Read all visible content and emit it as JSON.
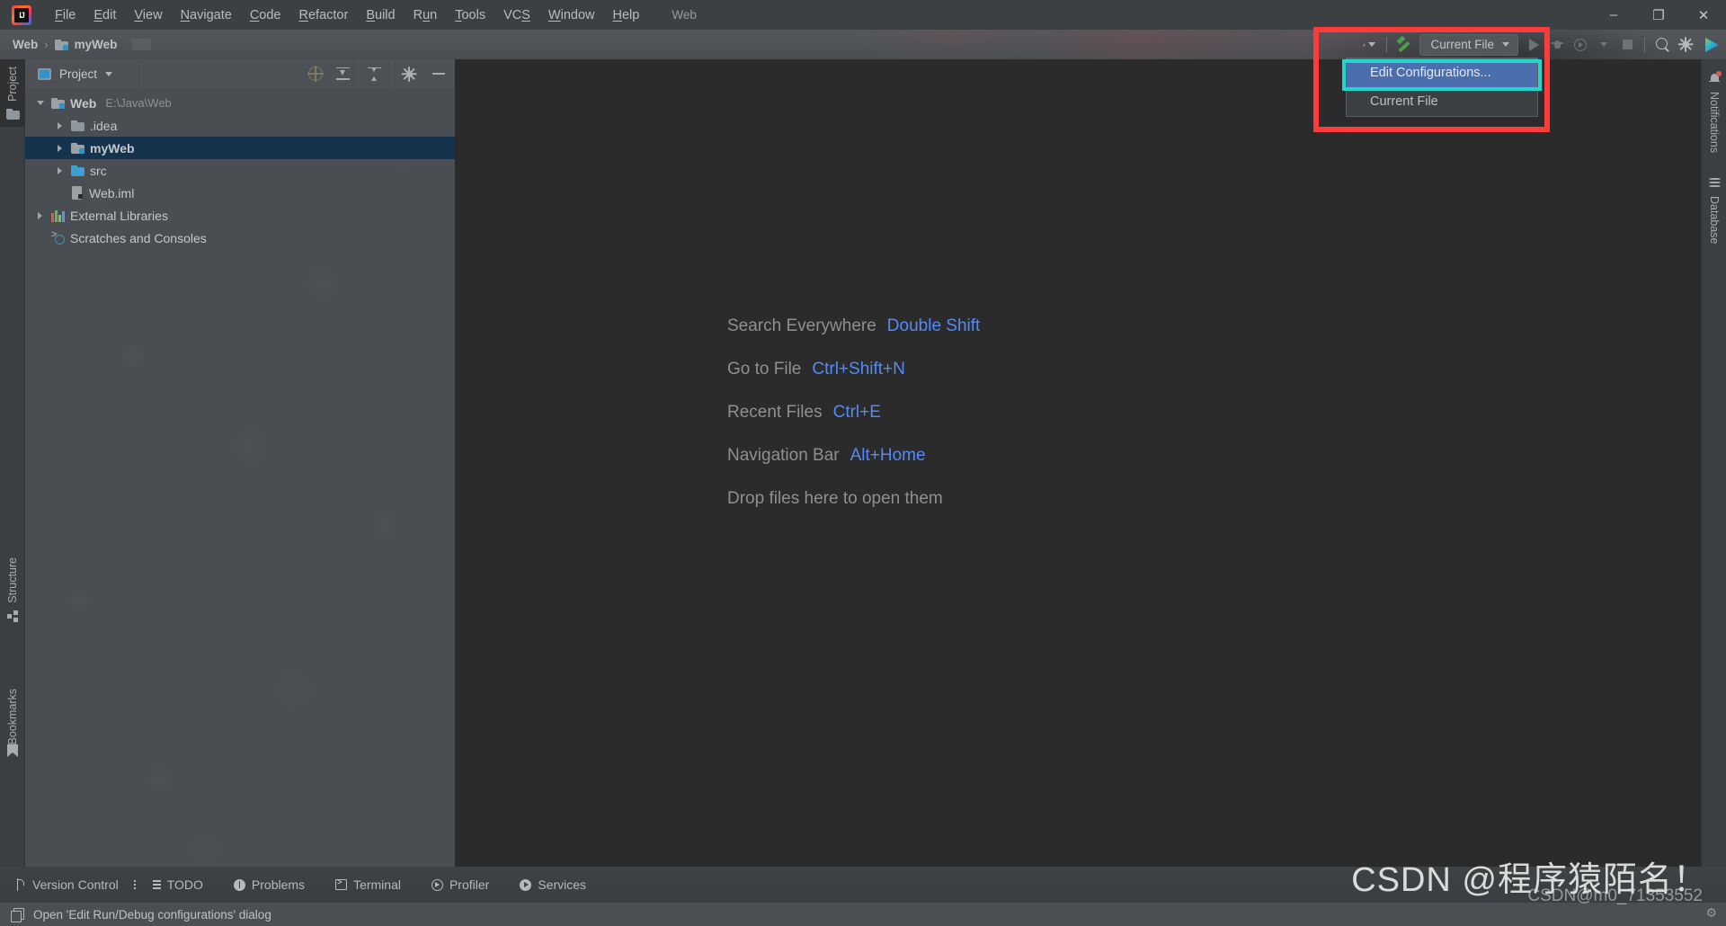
{
  "window": {
    "title": "Web",
    "minimize_label": "–",
    "restore_label": "❐",
    "close_label": "✕"
  },
  "menubar": {
    "logo_name": "intellij-idea-logo",
    "items": [
      {
        "label": "File",
        "mnemonic": "F"
      },
      {
        "label": "Edit",
        "mnemonic": "E"
      },
      {
        "label": "View",
        "mnemonic": "V"
      },
      {
        "label": "Navigate",
        "mnemonic": "N"
      },
      {
        "label": "Code",
        "mnemonic": "C"
      },
      {
        "label": "Refactor",
        "mnemonic": "R"
      },
      {
        "label": "Build",
        "mnemonic": "B"
      },
      {
        "label": "Run",
        "mnemonic": "u"
      },
      {
        "label": "Tools",
        "mnemonic": "T"
      },
      {
        "label": "VCS",
        "mnemonic": "S"
      },
      {
        "label": "Window",
        "mnemonic": "W"
      },
      {
        "label": "Help",
        "mnemonic": "H"
      }
    ]
  },
  "breadcrumb": {
    "root": "Web",
    "separator": "›",
    "current": "myWeb"
  },
  "toolbar": {
    "account_icon": "user-account-icon",
    "build_icon": "build-hammer-icon",
    "run_config_label": "Current File",
    "run_icon": "run-icon",
    "debug_icon": "debug-icon",
    "coverage_icon": "run-with-coverage-icon",
    "stop_icon": "stop-icon",
    "search_icon": "search-everywhere-icon",
    "settings_icon": "settings-gear-icon",
    "updates_icon": "ide-updates-icon"
  },
  "run_config_dropdown": {
    "items": [
      {
        "label": "Edit Configurations...",
        "selected": true
      },
      {
        "label": "Current File",
        "selected": false
      }
    ]
  },
  "annotations": {
    "red_box_color": "#fd3b3b",
    "cyan_box_color": "#22d6cc"
  },
  "left_stripe": {
    "tabs": [
      {
        "label": "Project",
        "icon": "project-folder-icon",
        "selected": true
      },
      {
        "label": "Structure",
        "icon": "structure-icon",
        "selected": false
      },
      {
        "label": "Bookmarks",
        "icon": "bookmarks-icon",
        "selected": false
      }
    ]
  },
  "right_stripe": {
    "tabs": [
      {
        "label": "Notifications",
        "icon": "notifications-bell-icon",
        "badge": true
      },
      {
        "label": "Database",
        "icon": "database-icon",
        "badge": false
      }
    ]
  },
  "project_panel": {
    "title": "Project",
    "title_caret": "▾",
    "tools": [
      {
        "name": "select-opened-file-icon",
        "label": "Select Opened File"
      },
      {
        "name": "expand-all-icon",
        "label": "Expand All"
      },
      {
        "name": "collapse-all-icon",
        "label": "Collapse All"
      },
      {
        "name": "options-gear-icon",
        "label": "Options"
      },
      {
        "name": "hide-panel-icon",
        "label": "Hide"
      }
    ],
    "tree": [
      {
        "label": "Web",
        "path": "E:\\Java\\Web",
        "icon": "module-folder-icon",
        "depth": 0,
        "expanded": true,
        "bold": true,
        "selected": false
      },
      {
        "label": ".idea",
        "path": "",
        "icon": "folder-icon",
        "depth": 1,
        "expanded": false,
        "bold": false,
        "selected": false
      },
      {
        "label": "myWeb",
        "path": "",
        "icon": "module-folder-icon",
        "depth": 1,
        "expanded": false,
        "bold": true,
        "selected": true
      },
      {
        "label": "src",
        "path": "",
        "icon": "source-folder-icon",
        "depth": 1,
        "expanded": false,
        "bold": false,
        "selected": false
      },
      {
        "label": "Web.iml",
        "path": "",
        "icon": "iml-file-icon",
        "depth": 1,
        "expanded": null,
        "bold": false,
        "selected": false
      },
      {
        "label": "External Libraries",
        "path": "",
        "icon": "libraries-icon",
        "depth": 0,
        "expanded": false,
        "bold": false,
        "selected": false
      },
      {
        "label": "Scratches and Consoles",
        "path": "",
        "icon": "scratches-icon",
        "depth": 0,
        "expanded": null,
        "bold": false,
        "selected": false
      }
    ]
  },
  "editor": {
    "hints": [
      {
        "label": "Search Everywhere",
        "shortcut": "Double Shift"
      },
      {
        "label": "Go to File",
        "shortcut": "Ctrl+Shift+N"
      },
      {
        "label": "Recent Files",
        "shortcut": "Ctrl+E"
      },
      {
        "label": "Navigation Bar",
        "shortcut": "Alt+Home"
      }
    ],
    "drop_hint": "Drop files here to open them"
  },
  "tool_window_bar": {
    "items": [
      {
        "label": "Version Control",
        "icon": "version-control-icon"
      },
      {
        "label": "TODO",
        "icon": "todo-icon"
      },
      {
        "label": "Problems",
        "icon": "problems-icon"
      },
      {
        "label": "Terminal",
        "icon": "terminal-icon"
      },
      {
        "label": "Profiler",
        "icon": "profiler-icon"
      },
      {
        "label": "Services",
        "icon": "services-icon"
      }
    ]
  },
  "status_bar": {
    "icon": "dialog-hint-icon",
    "message": "Open 'Edit Run/Debug configurations' dialog"
  },
  "watermark": {
    "main": "CSDN @程序猿陌名！",
    "sub": "CSDN@m0_71353552",
    "gear": "⚙"
  }
}
